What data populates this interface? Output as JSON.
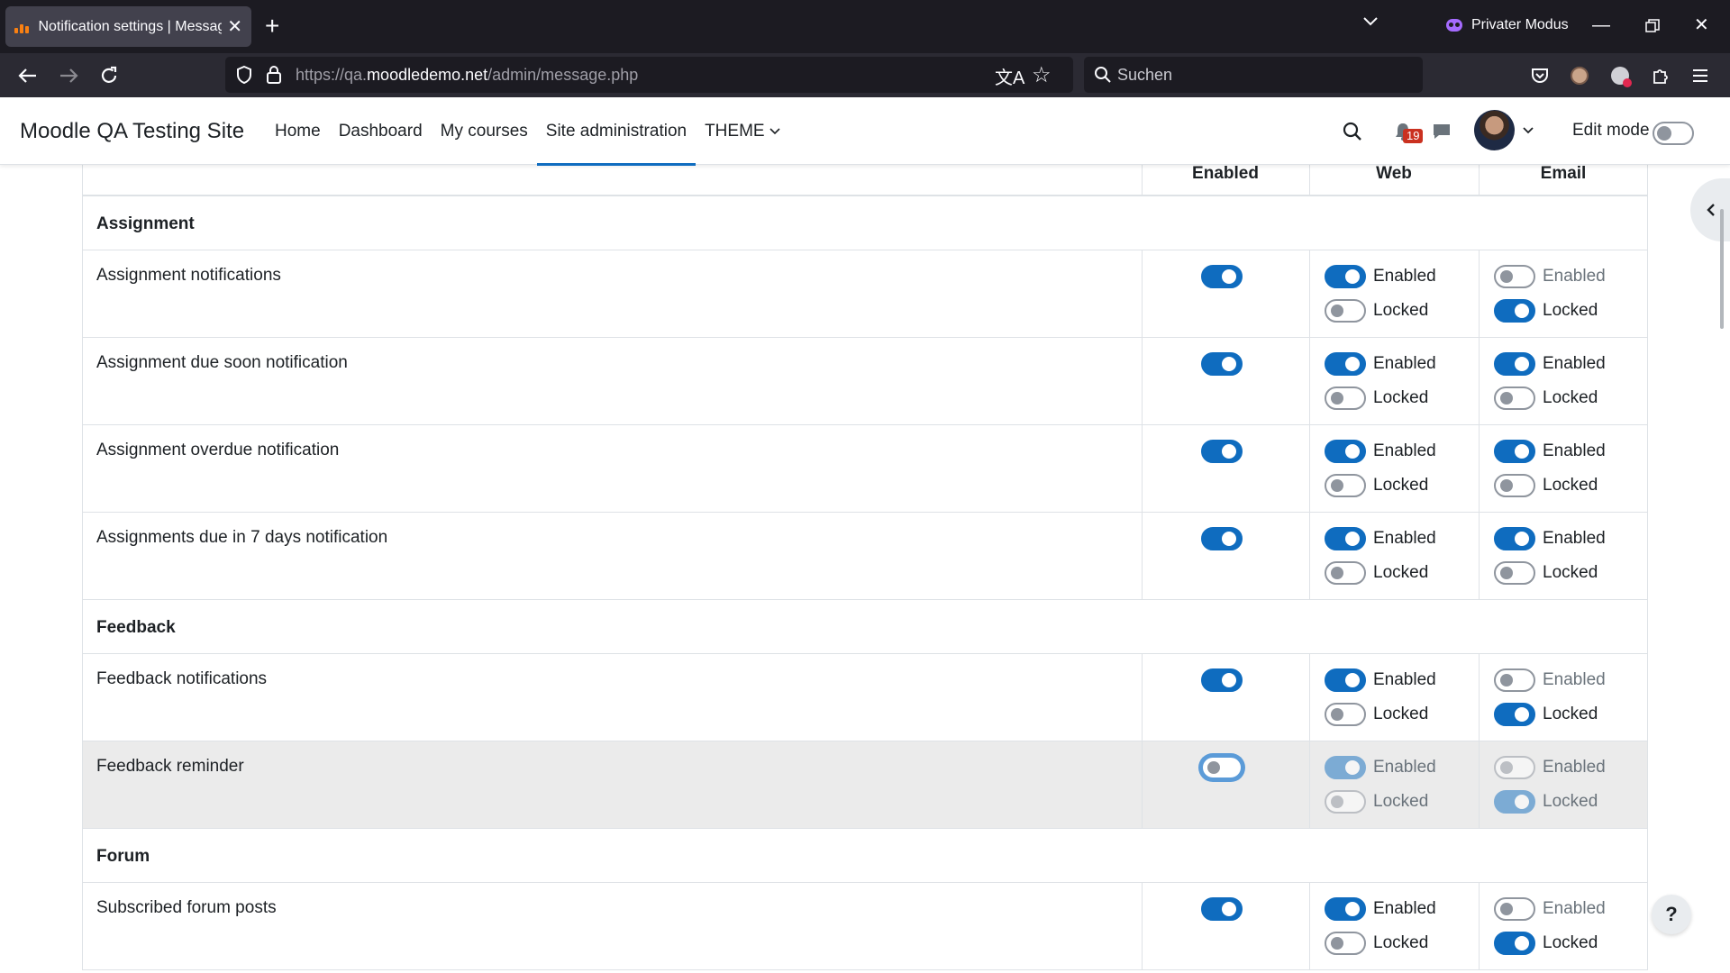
{
  "browser": {
    "tab_title": "Notification settings | Messagin",
    "private_label": "Privater Modus",
    "url_prefix": "https://qa.",
    "url_domain": "moodledemo.net",
    "url_path": "/admin/message.php",
    "search_placeholder": "Suchen"
  },
  "header": {
    "site_name": "Moodle QA Testing Site",
    "nav": [
      "Home",
      "Dashboard",
      "My courses",
      "Site administration",
      "THEME"
    ],
    "active_nav": "Site administration",
    "notification_count": "19",
    "edit_mode_label": "Edit mode"
  },
  "table": {
    "col_enabled": "Enabled",
    "col_web": "Web",
    "col_email": "Email",
    "enabled_label": "Enabled",
    "locked_label": "Locked",
    "sections": [
      {
        "title": "Assignment",
        "rows": [
          {
            "label": "Assignment notifications",
            "enabled": true,
            "web_enabled": true,
            "web_locked": false,
            "email_enabled": false,
            "email_locked": true
          },
          {
            "label": "Assignment due soon notification",
            "enabled": true,
            "web_enabled": true,
            "web_locked": false,
            "email_enabled": true,
            "email_locked": false
          },
          {
            "label": "Assignment overdue notification",
            "enabled": true,
            "web_enabled": true,
            "web_locked": false,
            "email_enabled": true,
            "email_locked": false
          },
          {
            "label": "Assignments due in 7 days notification",
            "enabled": true,
            "web_enabled": true,
            "web_locked": false,
            "email_enabled": true,
            "email_locked": false
          }
        ]
      },
      {
        "title": "Feedback",
        "rows": [
          {
            "label": "Feedback notifications",
            "enabled": true,
            "web_enabled": true,
            "web_locked": false,
            "email_enabled": false,
            "email_locked": true
          },
          {
            "label": "Feedback reminder",
            "enabled": false,
            "web_enabled": true,
            "web_locked": false,
            "email_enabled": false,
            "email_locked": true,
            "disabled": true
          }
        ]
      },
      {
        "title": "Forum",
        "rows": [
          {
            "label": "Subscribed forum posts",
            "enabled": true,
            "web_enabled": true,
            "web_locked": false,
            "email_enabled": false,
            "email_locked": true
          }
        ]
      }
    ]
  },
  "help_label": "?",
  "colors": {
    "accent": "#0f6cbf",
    "toggle_off": "#8f959e",
    "badge": "#ca3120"
  }
}
